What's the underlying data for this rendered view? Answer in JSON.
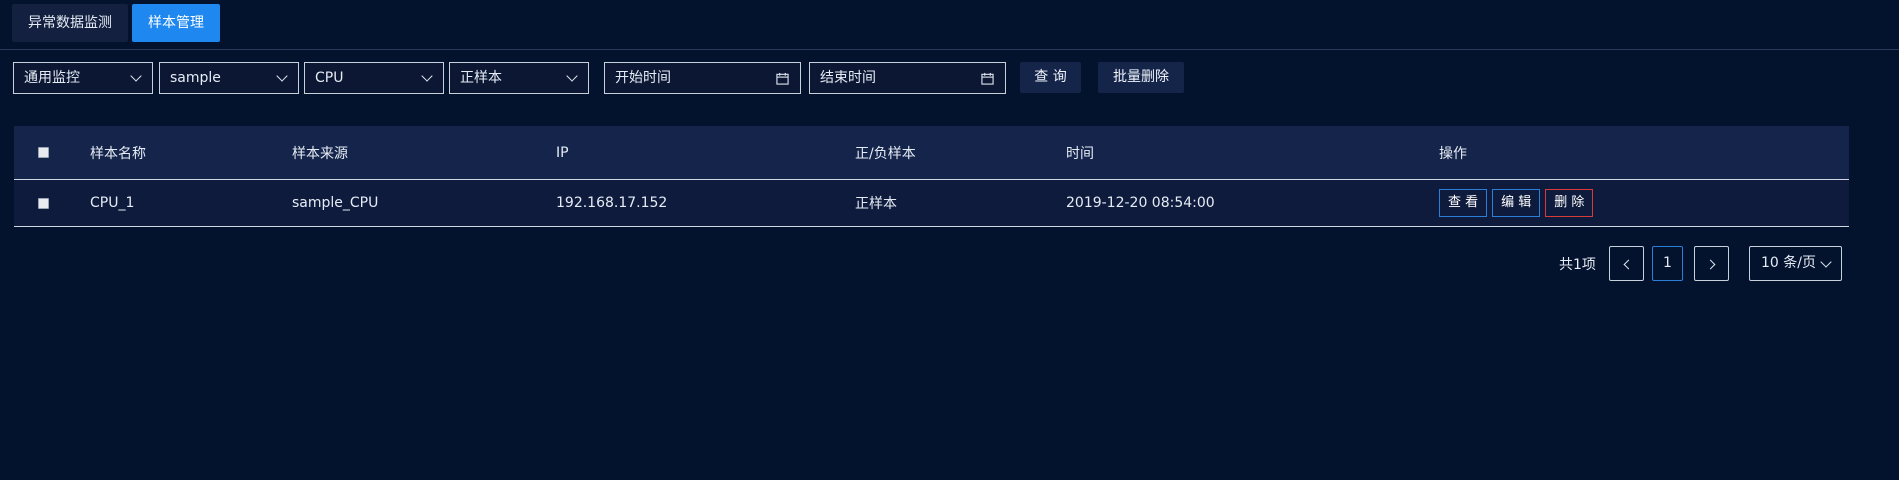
{
  "tabs": [
    {
      "label": "异常数据监测",
      "active": false
    },
    {
      "label": "样本管理",
      "active": true
    }
  ],
  "filters": {
    "monitor_type": "通用监控",
    "sample": "sample",
    "metric": "CPU",
    "sample_kind": "正样本",
    "start_placeholder": "开始时间",
    "end_placeholder": "结束时间",
    "query_label": "查 询",
    "batch_delete_label": "批量删除"
  },
  "table": {
    "headers": [
      "样本名称",
      "样本来源",
      "IP",
      "正/负样本",
      "时间",
      "操作"
    ],
    "rows": [
      {
        "name": "CPU_1",
        "source": "sample_CPU",
        "ip": "192.168.17.152",
        "kind": "正样本",
        "time": "2019-12-20 08:54:00",
        "actions": {
          "view": "查 看",
          "edit": "编 辑",
          "delete": "删 除"
        }
      }
    ]
  },
  "pagination": {
    "total_text": "共1项",
    "current_page": "1",
    "page_size": "10 条/页"
  },
  "colors": {
    "background": "#03122d",
    "accent": "#1e88f0",
    "danger": "#d93a3a"
  }
}
